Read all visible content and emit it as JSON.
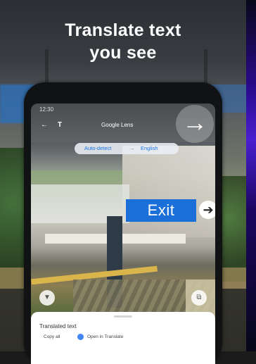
{
  "promo": {
    "line1": "Translate text",
    "line2": "you see"
  },
  "phone": {
    "status_time": "12:30",
    "app_title": "Google Lens",
    "icons": {
      "back": "arrow-left-icon",
      "text_mode": "text-t-icon",
      "more": "more-vert-icon"
    },
    "language": {
      "source": "Auto-detect",
      "arrow": "→",
      "target": "English"
    },
    "overlay": {
      "big_arrow": "→",
      "exit_text": "Exit",
      "exit_arrow": "➔"
    },
    "sheet": {
      "heading": "Translated text",
      "copy_all": "Copy all",
      "open_translate": "Open in Translate"
    }
  }
}
